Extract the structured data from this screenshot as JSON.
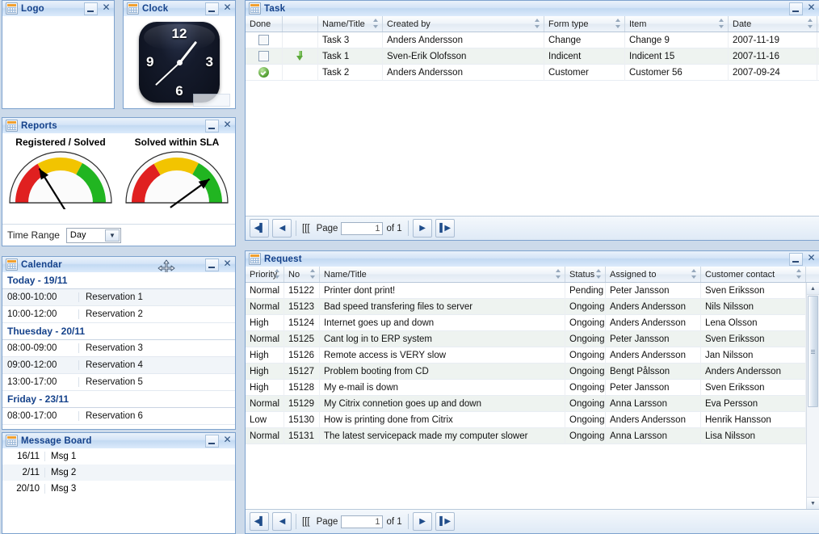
{
  "panels": {
    "logo": {
      "title": "Logo"
    },
    "clock": {
      "title": "Clock",
      "numbers": {
        "n12": "12",
        "n3": "3",
        "n6": "6",
        "n9": "9"
      }
    },
    "reports": {
      "title": "Reports"
    },
    "calendar": {
      "title": "Calendar"
    },
    "messages": {
      "title": "Message Board"
    },
    "task": {
      "title": "Task"
    },
    "request": {
      "title": "Request"
    }
  },
  "window_controls": {
    "minimize": "minimize-button",
    "close": "close-button"
  },
  "reports": {
    "time_range_label": "Time Range",
    "time_range_value": "Day",
    "time_range_options": [
      "Day"
    ]
  },
  "chart_data": [
    {
      "type": "gauge",
      "title": "Registered / Solved",
      "value": 22,
      "min": 0,
      "max": 100,
      "needle_angle_deg": -122,
      "bands": [
        {
          "label": "red",
          "from": 0,
          "to": 33,
          "color": "#e02020"
        },
        {
          "label": "yellow",
          "from": 33,
          "to": 66,
          "color": "#f2c400"
        },
        {
          "label": "green",
          "from": 66,
          "to": 100,
          "color": "#21b521"
        }
      ]
    },
    {
      "type": "gauge",
      "title": "Solved within SLA",
      "value": 84,
      "min": 0,
      "max": 100,
      "needle_angle_deg": -36,
      "bands": [
        {
          "label": "red",
          "from": 0,
          "to": 33,
          "color": "#e02020"
        },
        {
          "label": "yellow",
          "from": 33,
          "to": 66,
          "color": "#f2c400"
        },
        {
          "label": "green",
          "from": 66,
          "to": 100,
          "color": "#21b521"
        }
      ]
    }
  ],
  "calendar": {
    "groups": [
      {
        "day": "Today - 19/11",
        "items": [
          {
            "time": "08:00-10:00",
            "title": "Reservation 1"
          },
          {
            "time": "10:00-12:00",
            "title": "Reservation 2"
          }
        ]
      },
      {
        "day": "Thuesday - 20/11",
        "items": [
          {
            "time": "08:00-09:00",
            "title": "Reservation 3"
          },
          {
            "time": "09:00-12:00",
            "title": "Reservation 4"
          },
          {
            "time": "13:00-17:00",
            "title": "Reservation 5"
          }
        ]
      },
      {
        "day": "Friday - 23/11",
        "items": [
          {
            "time": "08:00-17:00",
            "title": "Reservation 6"
          }
        ]
      }
    ]
  },
  "messages": {
    "items": [
      {
        "date": "16/11",
        "text": "Msg 1"
      },
      {
        "date": "2/11",
        "text": "Msg 2"
      },
      {
        "date": "20/10",
        "text": "Msg 3"
      }
    ]
  },
  "task": {
    "columns": [
      {
        "label": "Done",
        "sortable": false
      },
      {
        "label": "",
        "sortable": false
      },
      {
        "label": "Name/Title",
        "sortable": true
      },
      {
        "label": "Created by",
        "sortable": true
      },
      {
        "label": "Form type",
        "sortable": true
      },
      {
        "label": "Item",
        "sortable": true
      },
      {
        "label": "Date",
        "sortable": true
      }
    ],
    "rows": [
      {
        "done": "unchecked",
        "flag": "",
        "name": "Task 3",
        "created_by": "Anders Andersson",
        "form_type": "Change",
        "item": "Change 9",
        "date": "2007-11-19"
      },
      {
        "done": "unchecked",
        "flag": "arrow-down",
        "name": "Task 1",
        "created_by": "Sven-Erik Olofsson",
        "form_type": "Indicent",
        "item": "Indicent 15",
        "date": "2007-11-16"
      },
      {
        "done": "checked",
        "flag": "",
        "name": "Task 2",
        "created_by": "Anders Andersson",
        "form_type": "Customer",
        "item": "Customer 56",
        "date": "2007-09-24"
      }
    ],
    "pager": {
      "prefix": "[[[",
      "page_label": "Page",
      "page_value": "1",
      "of_label": "of 1"
    }
  },
  "request": {
    "columns": [
      {
        "label": "Priority",
        "sortable": true
      },
      {
        "label": "No",
        "sortable": true
      },
      {
        "label": "Name/Title",
        "sortable": true
      },
      {
        "label": "Status",
        "sortable": true
      },
      {
        "label": "Assigned to",
        "sortable": true
      },
      {
        "label": "Customer contact",
        "sortable": true
      }
    ],
    "rows": [
      {
        "priority": "Normal",
        "no": "15122",
        "name": "Printer dont print!",
        "status": "Pending",
        "assigned_to": "Peter Jansson",
        "contact": "Sven Eriksson"
      },
      {
        "priority": "Normal",
        "no": "15123",
        "name": "Bad speed transfering files to server",
        "status": "Ongoing",
        "assigned_to": "Anders Andersson",
        "contact": "Nils Nilsson"
      },
      {
        "priority": "High",
        "no": "15124",
        "name": "Internet goes up and down",
        "status": "Ongoing",
        "assigned_to": "Anders Andersson",
        "contact": "Lena Olsson"
      },
      {
        "priority": "Normal",
        "no": "15125",
        "name": "Cant log in to ERP system",
        "status": "Ongoing",
        "assigned_to": "Peter Jansson",
        "contact": "Sven Eriksson"
      },
      {
        "priority": "High",
        "no": "15126",
        "name": "Remote access is VERY slow",
        "status": "Ongoing",
        "assigned_to": "Anders Andersson",
        "contact": "Jan Nilsson"
      },
      {
        "priority": "High",
        "no": "15127",
        "name": "Problem booting from CD",
        "status": "Ongoing",
        "assigned_to": "Bengt Pålsson",
        "contact": "Anders Andersson"
      },
      {
        "priority": "High",
        "no": "15128",
        "name": "My e-mail is down",
        "status": "Ongoing",
        "assigned_to": "Peter Jansson",
        "contact": "Sven Eriksson"
      },
      {
        "priority": "Normal",
        "no": "15129",
        "name": "My Citrix connetion goes up and down",
        "status": "Ongoing",
        "assigned_to": "Anna Larsson",
        "contact": "Eva Persson"
      },
      {
        "priority": "Low",
        "no": "15130",
        "name": "How is printing done from Citrix",
        "status": "Ongoing",
        "assigned_to": "Anders Andersson",
        "contact": "Henrik Hansson"
      },
      {
        "priority": "Normal",
        "no": "15131",
        "name": "The latest servicepack made my computer slower",
        "status": "Ongoing",
        "assigned_to": "Anna Larsson",
        "contact": "Lisa Nilsson"
      }
    ],
    "pager": {
      "prefix": "[[[",
      "page_label": "Page",
      "page_value": "1",
      "of_label": "of 1"
    }
  },
  "colors": {
    "titlebar_text": "#15428b",
    "desktop": "#ccdaea",
    "panel_border": "#7da2ce",
    "gauge_red": "#e02020",
    "gauge_yellow": "#f2c400",
    "gauge_green": "#21b521"
  }
}
